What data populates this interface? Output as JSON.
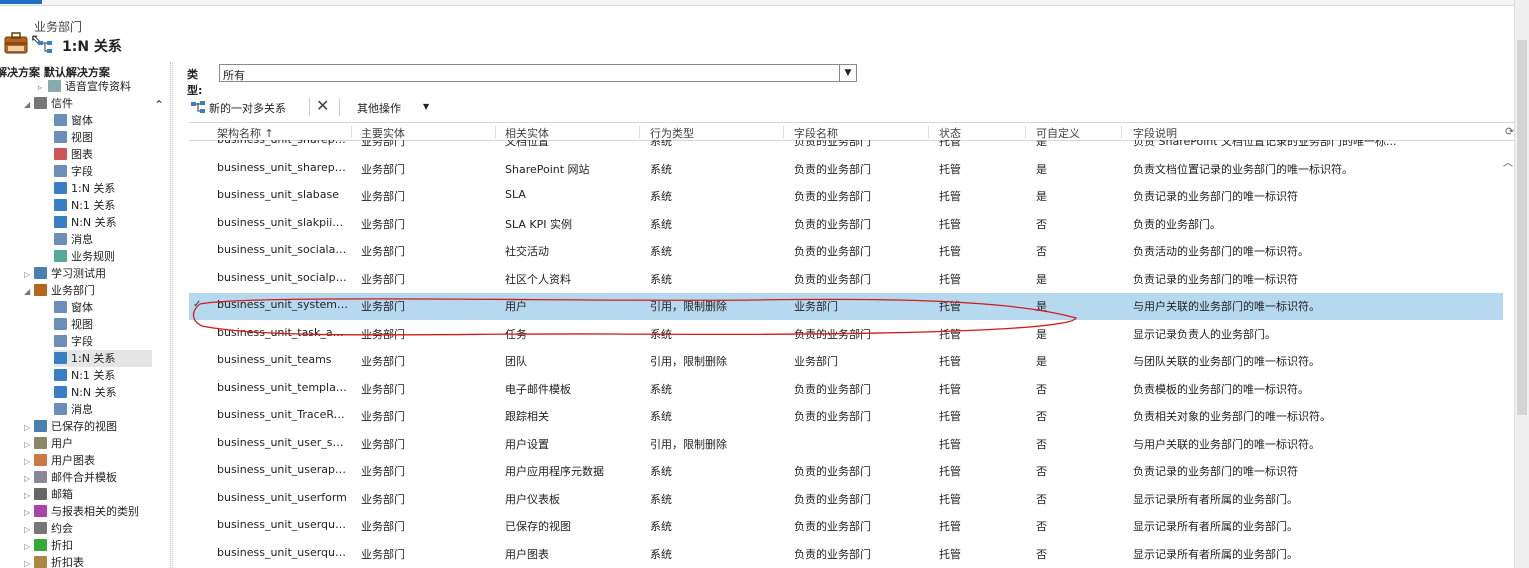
{
  "header": {
    "entity_name": "业务部门",
    "page_title": "1:N 关系"
  },
  "sidebar": {
    "solution_title": "解决方案 默认解决方案",
    "collapse_icon": "chevron-up-icon",
    "items": [
      {
        "label": "语音宣传资料",
        "icon": "doc-icon"
      },
      {
        "label": "信件",
        "icon": "letter-icon"
      },
      {
        "label": "窗体",
        "icon": "form-icon"
      },
      {
        "label": "视图",
        "icon": "view-icon"
      },
      {
        "label": "图表",
        "icon": "chart-icon"
      },
      {
        "label": "字段",
        "icon": "field-icon"
      },
      {
        "label": "1:N 关系",
        "icon": "relation-icon"
      },
      {
        "label": "N:1 关系",
        "icon": "relation-icon"
      },
      {
        "label": "N:N 关系",
        "icon": "relation-icon"
      },
      {
        "label": "消息",
        "icon": "message-icon"
      },
      {
        "label": "业务规则",
        "icon": "rule-icon"
      },
      {
        "label": "学习测试用",
        "icon": "entity-icon"
      },
      {
        "label": "业务部门",
        "icon": "briefcase-icon"
      },
      {
        "label": "窗体",
        "icon": "form-icon"
      },
      {
        "label": "视图",
        "icon": "view-icon"
      },
      {
        "label": "字段",
        "icon": "field-icon"
      },
      {
        "label": "1:N 关系",
        "icon": "relation-icon"
      },
      {
        "label": "N:1 关系",
        "icon": "relation-icon"
      },
      {
        "label": "N:N 关系",
        "icon": "relation-icon"
      },
      {
        "label": "消息",
        "icon": "message-icon"
      },
      {
        "label": "已保存的视图",
        "icon": "saved-view-icon"
      },
      {
        "label": "用户",
        "icon": "user-icon"
      },
      {
        "label": "用户图表",
        "icon": "user-chart-icon"
      },
      {
        "label": "邮件合并模板",
        "icon": "template-icon"
      },
      {
        "label": "邮箱",
        "icon": "mailbox-icon"
      },
      {
        "label": "与报表相关的类别",
        "icon": "report-category-icon"
      },
      {
        "label": "约会",
        "icon": "appointment-icon"
      },
      {
        "label": "折扣",
        "icon": "discount-icon"
      },
      {
        "label": "折扣表",
        "icon": "discount-list-icon"
      }
    ]
  },
  "filter": {
    "type_label": "类型:",
    "type_value": "所有"
  },
  "toolbar": {
    "new_label": "新的一对多关系",
    "more_label": "其他操作"
  },
  "grid": {
    "columns": [
      "架构名称 ↑",
      "主要实体",
      "相关实体",
      "行为类型",
      "字段名称",
      "状态",
      "可自定义",
      "字段说明"
    ],
    "rows": [
      {
        "schema": "business_unit_sharepo...",
        "primary": "业务部门",
        "related": "文档位置",
        "behavior": "系统",
        "field": "负责的业务部门",
        "state": "托管",
        "custom": "是",
        "desc": "负责 SharePoint 文档位置记录的业务部门的唯一标..."
      },
      {
        "schema": "business_unit_sharepo...",
        "primary": "业务部门",
        "related": "SharePoint 网站",
        "behavior": "系统",
        "field": "负责的业务部门",
        "state": "托管",
        "custom": "是",
        "desc": "负责文档位置记录的业务部门的唯一标识符。"
      },
      {
        "schema": "business_unit_slabase",
        "primary": "业务部门",
        "related": "SLA",
        "behavior": "系统",
        "field": "负责的业务部门",
        "state": "托管",
        "custom": "是",
        "desc": "负责记录的业务部门的唯一标识符"
      },
      {
        "schema": "business_unit_slakpiin...",
        "primary": "业务部门",
        "related": "SLA KPI 实例",
        "behavior": "系统",
        "field": "负责的业务部门",
        "state": "托管",
        "custom": "否",
        "desc": "负责的业务部门。"
      },
      {
        "schema": "business_unit_socialac...",
        "primary": "业务部门",
        "related": "社交活动",
        "behavior": "系统",
        "field": "负责的业务部门",
        "state": "托管",
        "custom": "否",
        "desc": "负责活动的业务部门的唯一标识符。"
      },
      {
        "schema": "business_unit_socialpr...",
        "primary": "业务部门",
        "related": "社区个人资料",
        "behavior": "系统",
        "field": "负责的业务部门",
        "state": "托管",
        "custom": "是",
        "desc": "负责记录的业务部门的唯一标识符"
      },
      {
        "schema": "business_unit_system_...",
        "primary": "业务部门",
        "related": "用户",
        "behavior": "引用，限制删除",
        "field": "业务部门",
        "state": "托管",
        "custom": "是",
        "desc": "与用户关联的业务部门的唯一标识符。"
      },
      {
        "schema": "business_unit_task_act...",
        "primary": "业务部门",
        "related": "任务",
        "behavior": "系统",
        "field": "负责的业务部门",
        "state": "托管",
        "custom": "是",
        "desc": "显示记录负责人的业务部门。"
      },
      {
        "schema": "business_unit_teams",
        "primary": "业务部门",
        "related": "团队",
        "behavior": "引用，限制删除",
        "field": "业务部门",
        "state": "托管",
        "custom": "是",
        "desc": "与团队关联的业务部门的唯一标识符。"
      },
      {
        "schema": "business_unit_templat...",
        "primary": "业务部门",
        "related": "电子邮件模板",
        "behavior": "系统",
        "field": "负责的业务部门",
        "state": "托管",
        "custom": "否",
        "desc": "负责模板的业务部门的唯一标识符。"
      },
      {
        "schema": "business_unit_TraceRe...",
        "primary": "业务部门",
        "related": "跟踪相关",
        "behavior": "系统",
        "field": "负责的业务部门",
        "state": "托管",
        "custom": "否",
        "desc": "负责相关对象的业务部门的唯一标识符。"
      },
      {
        "schema": "business_unit_user_set...",
        "primary": "业务部门",
        "related": "用户设置",
        "behavior": "引用，限制删除",
        "field": "",
        "state": "托管",
        "custom": "否",
        "desc": "与用户关联的业务部门的唯一标识符。"
      },
      {
        "schema": "business_unit_userapp...",
        "primary": "业务部门",
        "related": "用户应用程序元数据",
        "behavior": "系统",
        "field": "负责的业务部门",
        "state": "托管",
        "custom": "否",
        "desc": "负责记录的业务部门的唯一标识符"
      },
      {
        "schema": "business_unit_userform",
        "primary": "业务部门",
        "related": "用户仪表板",
        "behavior": "系统",
        "field": "负责的业务部门",
        "state": "托管",
        "custom": "否",
        "desc": "显示记录所有者所属的业务部门。"
      },
      {
        "schema": "business_unit_userque...",
        "primary": "业务部门",
        "related": "已保存的视图",
        "behavior": "系统",
        "field": "负责的业务部门",
        "state": "托管",
        "custom": "否",
        "desc": "显示记录所有者所属的业务部门。"
      },
      {
        "schema": "business_unit_userque...",
        "primary": "业务部门",
        "related": "用户图表",
        "behavior": "系统",
        "field": "负责的业务部门",
        "state": "托管",
        "custom": "否",
        "desc": "显示记录所有者所属的业务部门。"
      }
    ],
    "selected_index": 6
  },
  "colors": {
    "selected_row": "#b7d9f0",
    "accent": "#1f6fc4",
    "annotation": "#d11a1a"
  }
}
